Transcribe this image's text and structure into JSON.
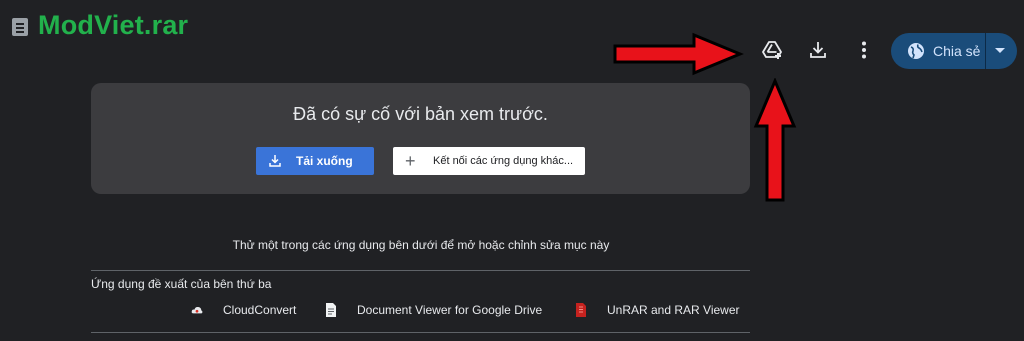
{
  "header": {
    "title": "ModViet.rar",
    "file_icon": "archive-file-icon"
  },
  "toolbar": {
    "add_shortcut_icon": "add-to-drive-icon",
    "download_icon": "download-icon",
    "more_icon": "more-vert-icon",
    "share_label": "Chia sẻ",
    "share_icon": "globe-icon",
    "share_menu_icon": "caret-down-icon"
  },
  "preview": {
    "message": "Đã có sự cố với bản xem trước.",
    "download_label": "Tải xuống",
    "connect_label": "Kết nối các ứng dụng khác..."
  },
  "apps": {
    "hint": "Thử một trong các ứng dụng bên dưới để mở hoặc chỉnh sửa mục này",
    "section_label": "Ứng dụng đề xuất của bên thứ ba",
    "items": [
      {
        "label": "CloudConvert",
        "icon": "cloudconvert-icon"
      },
      {
        "label": "Document Viewer for Google Drive",
        "icon": "document-icon"
      },
      {
        "label": "UnRAR and RAR Viewer",
        "icon": "rar-file-icon"
      }
    ]
  },
  "colors": {
    "background": "#202124",
    "title": "#22b14c",
    "share": "#1a4c7a",
    "primary_button": "#3a74d8",
    "annotation": "#e8121a"
  }
}
